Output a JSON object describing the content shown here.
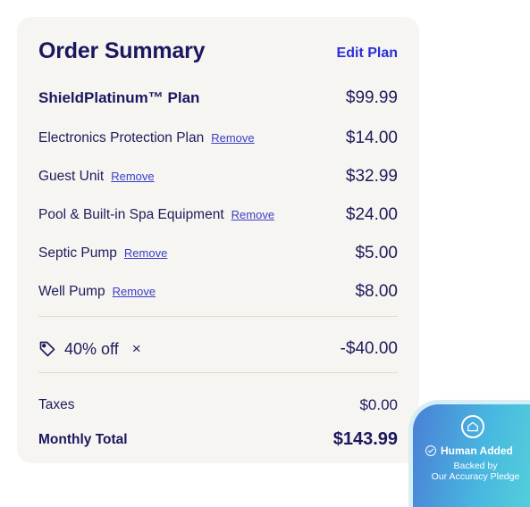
{
  "summary": {
    "title": "Order Summary",
    "edit_label": "Edit Plan",
    "plan": {
      "name": "ShieldPlatinum™ Plan",
      "price": "$99.99"
    },
    "remove_label": "Remove",
    "items": [
      {
        "name": "Electronics Protection Plan",
        "price": "$14.00"
      },
      {
        "name": "Guest Unit",
        "price": "$32.99"
      },
      {
        "name": "Pool & Built-in Spa Equipment",
        "price": "$24.00"
      },
      {
        "name": "Septic Pump",
        "price": "$5.00"
      },
      {
        "name": "Well Pump",
        "price": "$8.00"
      }
    ],
    "promo": {
      "label": "40% off",
      "remove_symbol": "×",
      "amount": "-$40.00",
      "icon": "tag-icon"
    },
    "taxes": {
      "label": "Taxes",
      "value": "$0.00"
    },
    "total": {
      "label": "Monthly Total",
      "value": "$143.99"
    }
  },
  "badge": {
    "line1": "Human Added",
    "line2": "Backed by",
    "line3": "Our Accuracy Pledge",
    "icons": [
      "home-icon",
      "check-circle-icon"
    ]
  },
  "colors": {
    "card_bg": "#f6f5f1",
    "heading": "#1b1760",
    "link": "#2b2fd9",
    "badge_gradient_start": "#4a7fd6",
    "badge_gradient_end": "#56d3da"
  }
}
